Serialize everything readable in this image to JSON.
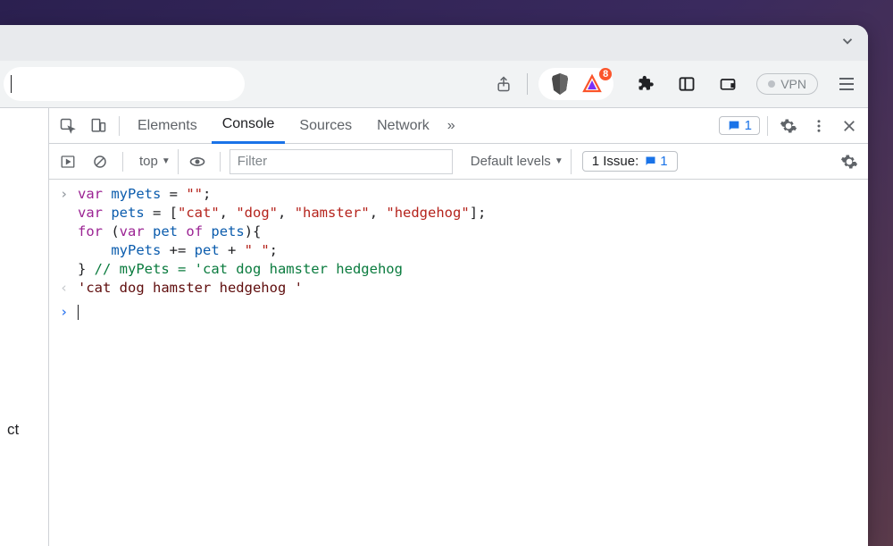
{
  "chrome": {
    "share_tooltip": "Share",
    "vpn_label": "VPN",
    "badge_count": "8"
  },
  "devtools": {
    "tabs": {
      "elements": "Elements",
      "console": "Console",
      "sources": "Sources",
      "network": "Network",
      "more": "»"
    },
    "messages_count": "1",
    "toolbar": {
      "context_label": "top",
      "filter_placeholder": "Filter",
      "levels_label": "Default levels",
      "issue_label": "1 Issue:",
      "issue_count": "1"
    }
  },
  "left_panel": {
    "fragment": "ct"
  },
  "console": {
    "line1_kw1": "var",
    "line1_id1": "myPets",
    "line1_eq": " = ",
    "line1_str": "\"\"",
    "line1_semi": ";",
    "line2_kw1": "var",
    "line2_id1": "pets",
    "line2_eq": " = [",
    "line2_s1": "\"cat\"",
    "line2_c1": ", ",
    "line2_s2": "\"dog\"",
    "line2_c2": ", ",
    "line2_s3": "\"hamster\"",
    "line2_c3": ", ",
    "line2_s4": "\"hedgehog\"",
    "line2_end": "];",
    "line3_kw1": "for",
    "line3_p1": " (",
    "line3_kw2": "var",
    "line3_sp1": " ",
    "line3_id1": "pet",
    "line3_sp2": " ",
    "line3_kw3": "of",
    "line3_sp3": " ",
    "line3_id2": "pets",
    "line3_p2": "){",
    "line4_indent": "    ",
    "line4_id1": "myPets",
    "line4_op": " += ",
    "line4_id2": "pet",
    "line4_plus": " + ",
    "line4_str": "\" \"",
    "line4_semi": ";",
    "line5_brace": "} ",
    "line5_comment": "// myPets = 'cat dog hamster hedgehog",
    "output": "'cat dog hamster hedgehog '"
  }
}
